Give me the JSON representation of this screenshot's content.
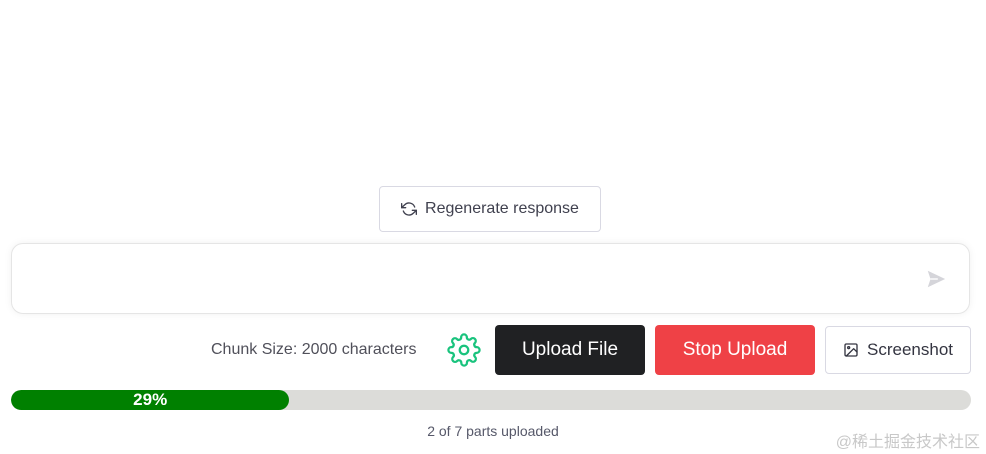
{
  "regenerate": {
    "label": "Regenerate response",
    "icon": "refresh-icon"
  },
  "prompt": {
    "value": "",
    "placeholder": "",
    "send_icon": "send-icon"
  },
  "controls": {
    "chunk_label": "Chunk Size: 2000 characters",
    "settings_icon": "gear-icon",
    "upload_label": "Upload File",
    "stop_label": "Stop Upload",
    "screenshot_label": "Screenshot",
    "screenshot_icon": "image-icon"
  },
  "progress": {
    "percent": 29,
    "text": "29%",
    "status": "2 of 7 parts uploaded"
  },
  "watermark": "@稀土掘金技术社区",
  "colors": {
    "progress_fill": "#008000",
    "progress_track": "#dcdcd9",
    "stop_button": "#ef4146",
    "upload_button": "#202123",
    "gear_icon": "#19c37d"
  }
}
